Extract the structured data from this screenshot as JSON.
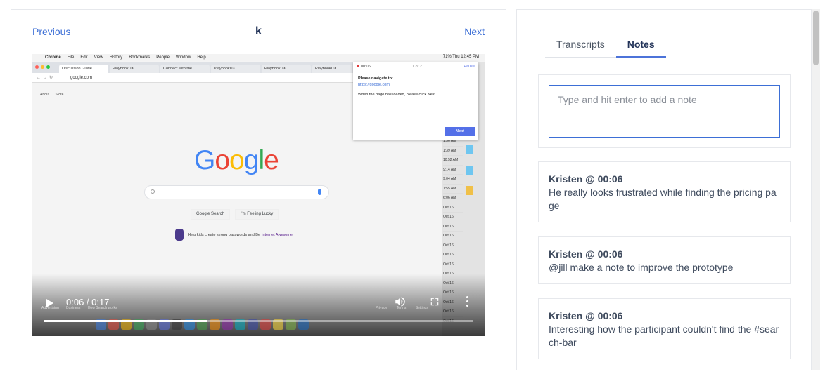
{
  "nav": {
    "previous": "Previous",
    "next": "Next",
    "participant": "k"
  },
  "video": {
    "screen": {
      "menubar": [
        "Chrome",
        "File",
        "Edit",
        "View",
        "History",
        "Bookmarks",
        "People",
        "Window",
        "Help"
      ],
      "menubar_right": "71% Thu 12:45 PM",
      "tabs": [
        "Discussion Guide",
        "PlaybookUX",
        "Connect with the",
        "PlaybookUX",
        "PlaybookUX",
        "PlaybookUX"
      ],
      "url": "google.com",
      "page_links": [
        "About",
        "Store"
      ],
      "google_logo": "Google",
      "search_buttons": [
        "Google Search",
        "I'm Feeling Lucky"
      ],
      "promo_text": "Help kids create strong passwords and Be",
      "promo_link": "Internet Awesome",
      "footer_left": [
        "Advertising",
        "Business",
        "How Search works"
      ],
      "footer_right": [
        "Privacy",
        "Terms",
        "Settings"
      ],
      "side_times": [
        "1:36 AM",
        "1:39 AM",
        "10:52 AM",
        "9:14 AM",
        "9:04 AM",
        "1:55 AM",
        "6:06 AM",
        "Oct 16",
        "Oct 16",
        "Oct 16",
        "Oct 16",
        "Oct 16",
        "Oct 16",
        "Oct 16",
        "Oct 16",
        "Oct 16",
        "Oct 16",
        "Oct 16",
        "Oct 16",
        "Oct 16"
      ],
      "popup": {
        "timer": "00:06",
        "step": "1 of 2",
        "pause": "Pause",
        "instruction": "Please navigate to:",
        "url": "https://google.com",
        "loaded": "When the page has loaded, please click Next",
        "button": "Next"
      }
    },
    "time_display": "0:06 / 0:17",
    "progress": 0.38
  },
  "panel": {
    "tabs": [
      {
        "label": "Transcripts",
        "active": false
      },
      {
        "label": "Notes",
        "active": true
      }
    ],
    "note_placeholder": "Type and hit enter to add a note",
    "notes": [
      {
        "author": "Kristen @ 00:06",
        "text": "He really looks frustrated while finding the pricing page"
      },
      {
        "author": "Kristen @ 00:06",
        "text": "@jill make a note to improve the prototype"
      },
      {
        "author": "Kristen @ 00:06",
        "text": "Interesting how the participant couldn't find the #search-bar"
      }
    ]
  },
  "colors": {
    "accent": "#3d6fd6",
    "heading": "#233459",
    "tab_underline": "#4c73d9",
    "text": "#3f4b5e"
  }
}
